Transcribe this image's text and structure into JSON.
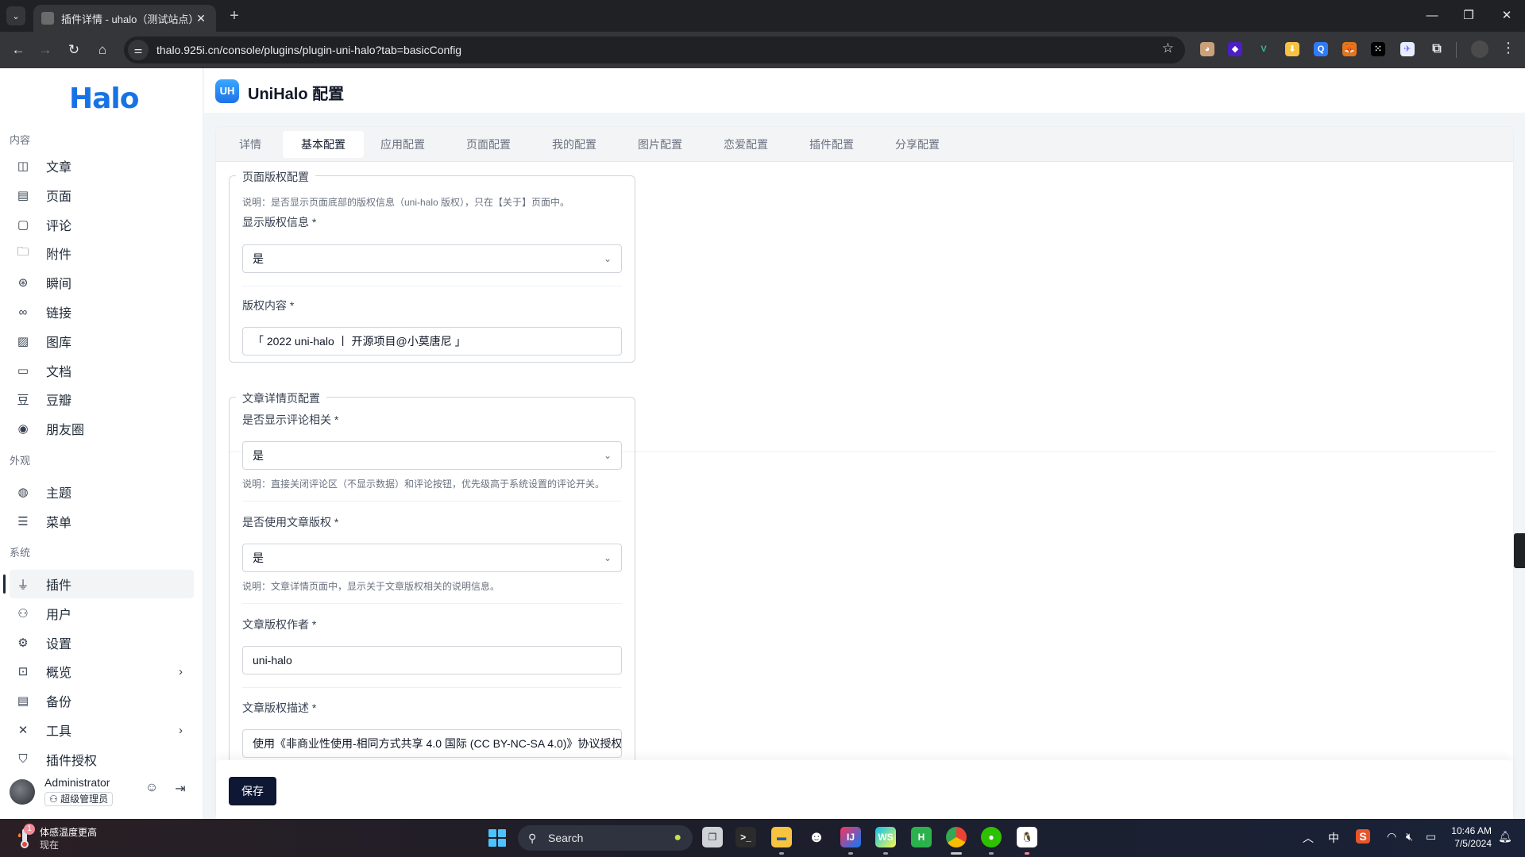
{
  "browser": {
    "tab_title": "插件详情 - uhalo（测试站点）",
    "url": "thalo.925i.cn/console/plugins/plugin-uni-halo?tab=basicConfig",
    "extensions": [
      {
        "name": "avatar-extension",
        "color": "#c9a27a",
        "glyph": "◕"
      },
      {
        "name": "layers-extension",
        "color": "#4c1fc4",
        "glyph": "◆"
      },
      {
        "name": "vue-devtools-extension",
        "color": "#35363a",
        "glyph": "V"
      },
      {
        "name": "download-extension",
        "color": "#f5c244",
        "glyph": "⬇"
      },
      {
        "name": "q-extension",
        "color": "#2f7bf5",
        "glyph": "Q"
      },
      {
        "name": "metamask-extension",
        "color": "#e2761b",
        "glyph": "🦊"
      },
      {
        "name": "dice-extension",
        "color": "#000000",
        "glyph": "⁙"
      },
      {
        "name": "bird-extension",
        "color": "#e8ecff",
        "glyph": "✈"
      }
    ]
  },
  "sidebar": {
    "logo": "Halo",
    "groups": [
      {
        "label": "内容",
        "items": [
          {
            "label": "文章",
            "icon": "book-icon",
            "glyph": "◫"
          },
          {
            "label": "页面",
            "icon": "page-icon",
            "glyph": "▤"
          },
          {
            "label": "评论",
            "icon": "comment-icon",
            "glyph": "▢"
          },
          {
            "label": "附件",
            "icon": "folder-icon",
            "glyph": "🗀"
          },
          {
            "label": "瞬间",
            "icon": "aperture-icon",
            "glyph": "⊛"
          },
          {
            "label": "链接",
            "icon": "link-icon",
            "glyph": "∞"
          },
          {
            "label": "图库",
            "icon": "image-icon",
            "glyph": "▨"
          },
          {
            "label": "文档",
            "icon": "doc-icon",
            "glyph": "▭"
          },
          {
            "label": "豆瓣",
            "icon": "douban-icon",
            "glyph": "豆"
          },
          {
            "label": "朋友圈",
            "icon": "moments-icon",
            "glyph": "◉"
          }
        ]
      },
      {
        "label": "外观",
        "items": [
          {
            "label": "主题",
            "icon": "palette-icon",
            "glyph": "◍"
          },
          {
            "label": "菜单",
            "icon": "menu-settings-icon",
            "glyph": "☰"
          }
        ]
      },
      {
        "label": "系统",
        "items": [
          {
            "label": "插件",
            "icon": "plug-icon",
            "glyph": "⏚",
            "active": true
          },
          {
            "label": "用户",
            "icon": "user-settings-icon",
            "glyph": "⚇"
          },
          {
            "label": "设置",
            "icon": "gear-icon",
            "glyph": "⚙"
          },
          {
            "label": "概览",
            "icon": "terminal-icon",
            "glyph": "⊡",
            "has_children": true
          },
          {
            "label": "备份",
            "icon": "backup-icon",
            "glyph": "▤"
          },
          {
            "label": "工具",
            "icon": "tools-icon",
            "glyph": "✕",
            "has_children": true
          },
          {
            "label": "插件授权",
            "icon": "shield-key-icon",
            "glyph": "⛉"
          }
        ]
      }
    ],
    "user": {
      "name": "Administrator",
      "role": "超级管理员"
    }
  },
  "header": {
    "plugin_logo": "UH",
    "title": "UniHalo 配置"
  },
  "tabs": [
    {
      "label": "详情"
    },
    {
      "label": "基本配置",
      "active": true
    },
    {
      "label": "应用配置"
    },
    {
      "label": "页面配置"
    },
    {
      "label": "我的配置"
    },
    {
      "label": "图片配置"
    },
    {
      "label": "恋爱配置"
    },
    {
      "label": "插件配置"
    },
    {
      "label": "分享配置"
    }
  ],
  "form": {
    "page_copyright": {
      "legend": "页面版权配置",
      "help": "说明：是否显示页面底部的版权信息（uni-halo 版权），只在【关于】页面中。",
      "show_label": "显示版权信息 *",
      "show_value": "是",
      "content_label": "版权内容 *",
      "content_value": "「 2022 uni-halo 丨 开源项目@小莫唐尼 」"
    },
    "article_detail": {
      "legend": "文章详情页配置",
      "comment_label": "是否显示评论相关 *",
      "comment_value": "是",
      "comment_help": "说明：直接关闭评论区（不显示数据）和评论按钮，优先级高于系统设置的评论开关。",
      "copyright_label": "是否使用文章版权 *",
      "copyright_value": "是",
      "copyright_help": "说明：文章详情页面中，显示关于文章版权相关的说明信息。",
      "author_label": "文章版权作者 *",
      "author_value": "uni-halo",
      "desc_label": "文章版权描述 *",
      "desc_value": "使用《非商业性使用-相同方式共享 4.0 国际 (CC BY-NC-SA 4.0)》协议授权"
    },
    "save_label": "保存"
  },
  "taskbar": {
    "weather_title": "体感温度更高",
    "weather_sub": "现在",
    "weather_badge": "1",
    "search_label": "Search",
    "ime": "中",
    "time": "10:46 AM",
    "date": "7/5/2024"
  }
}
